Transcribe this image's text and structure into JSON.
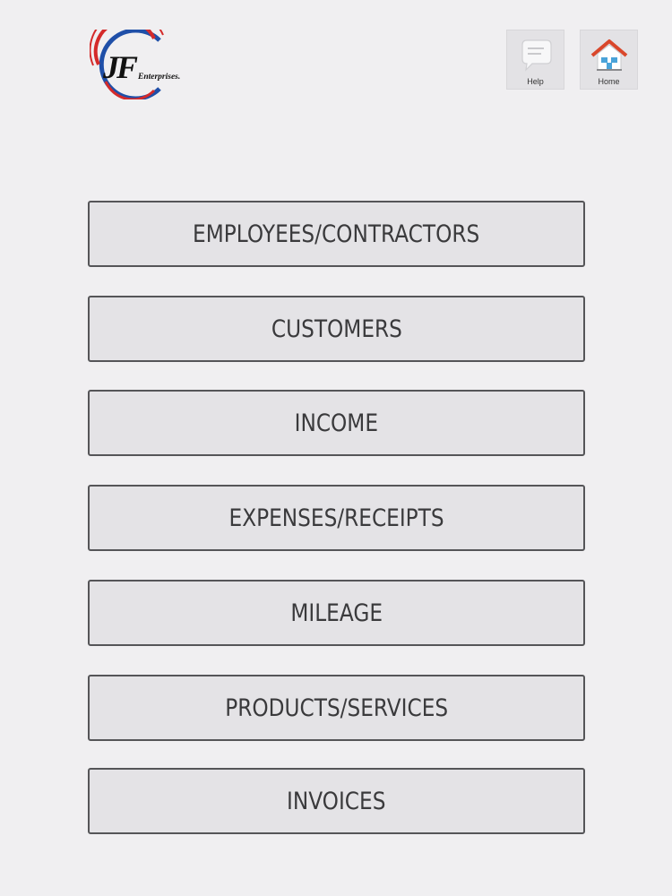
{
  "header": {
    "logo": {
      "initials": "JF",
      "company": "Enterprises."
    },
    "help_button": {
      "label": "Help",
      "icon": "chat-bubble-icon"
    },
    "home_button": {
      "label": "Home",
      "icon": "house-icon"
    }
  },
  "menu": {
    "items": [
      {
        "id": "employees",
        "label": "EMPLOYEES/CONTRACTORS"
      },
      {
        "id": "customers",
        "label": "CUSTOMERS"
      },
      {
        "id": "income",
        "label": "INCOME"
      },
      {
        "id": "expenses",
        "label": "EXPENSES/RECEIPTS"
      },
      {
        "id": "mileage",
        "label": "MILEAGE"
      },
      {
        "id": "products",
        "label": "PRODUCTS/SERVICES"
      },
      {
        "id": "invoices",
        "label": "INVOICES"
      }
    ]
  },
  "colors": {
    "background": "#f0eff1",
    "button_fill": "#e4e3e6",
    "button_border": "#555558",
    "logo_red": "#d42a2a",
    "logo_blue": "#1f4fa8",
    "house_roof": "#d9472b"
  }
}
